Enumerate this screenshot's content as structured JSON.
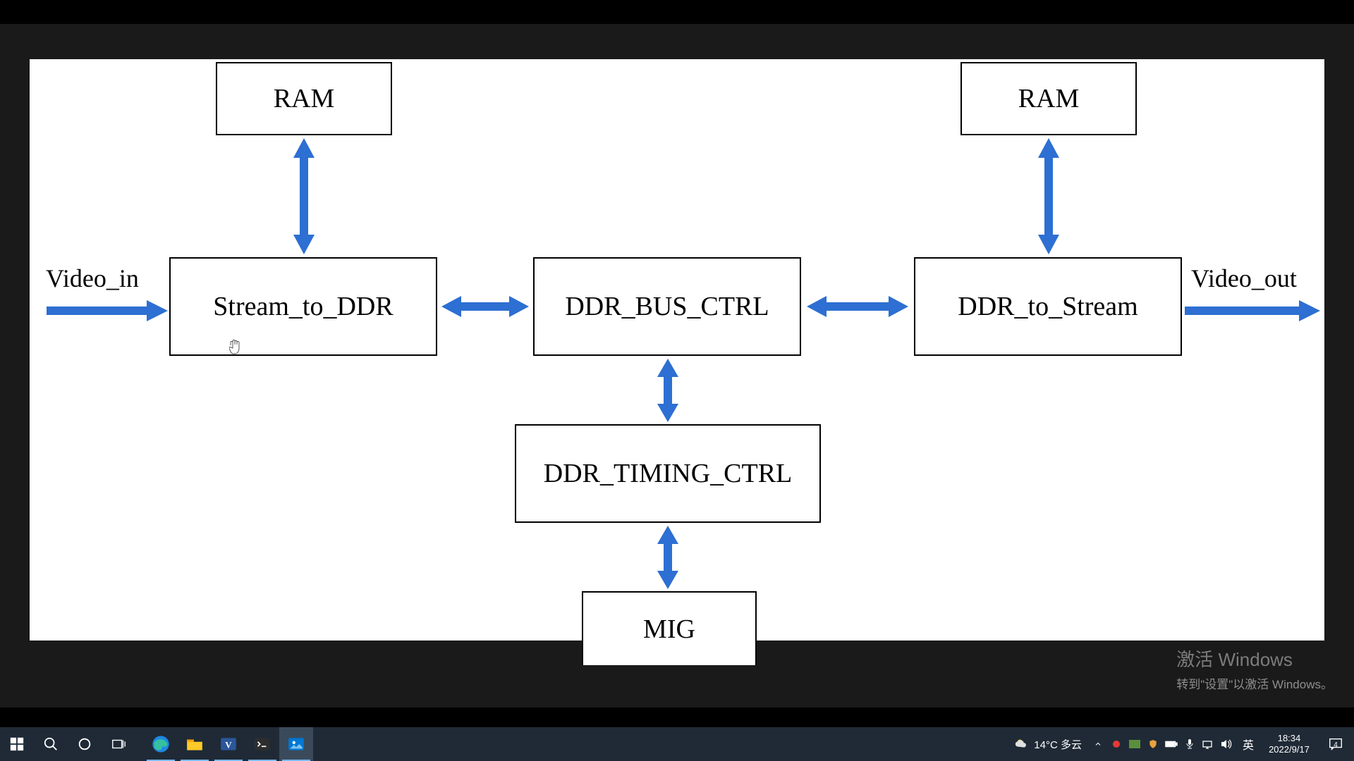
{
  "diagram": {
    "blocks": {
      "ram_left": "RAM",
      "ram_right": "RAM",
      "stream_to_ddr": "Stream_to_DDR",
      "ddr_bus_ctrl": "DDR_BUS_CTRL",
      "ddr_to_stream": "DDR_to_Stream",
      "ddr_timing_ctrl": "DDR_TIMING_CTRL",
      "mig": "MIG"
    },
    "labels": {
      "video_in": "Video_in",
      "video_out": "Video_out"
    },
    "arrow_color": "#2d6fd2"
  },
  "watermark": {
    "line1": "激活 Windows",
    "line2": "转到\"设置\"以激活 Windows。"
  },
  "taskbar": {
    "weather_text": "14°C 多云",
    "ime": "英",
    "time": "18:34",
    "date": "2022/9/17",
    "notification_count": "4",
    "apps": {
      "start": "Start",
      "search": "Search",
      "cortana": "Cortana",
      "taskview": "Task View",
      "edge": "Edge",
      "explorer": "File Explorer",
      "visio": "Visio",
      "terminal": "Terminal",
      "photos": "Photos"
    }
  }
}
